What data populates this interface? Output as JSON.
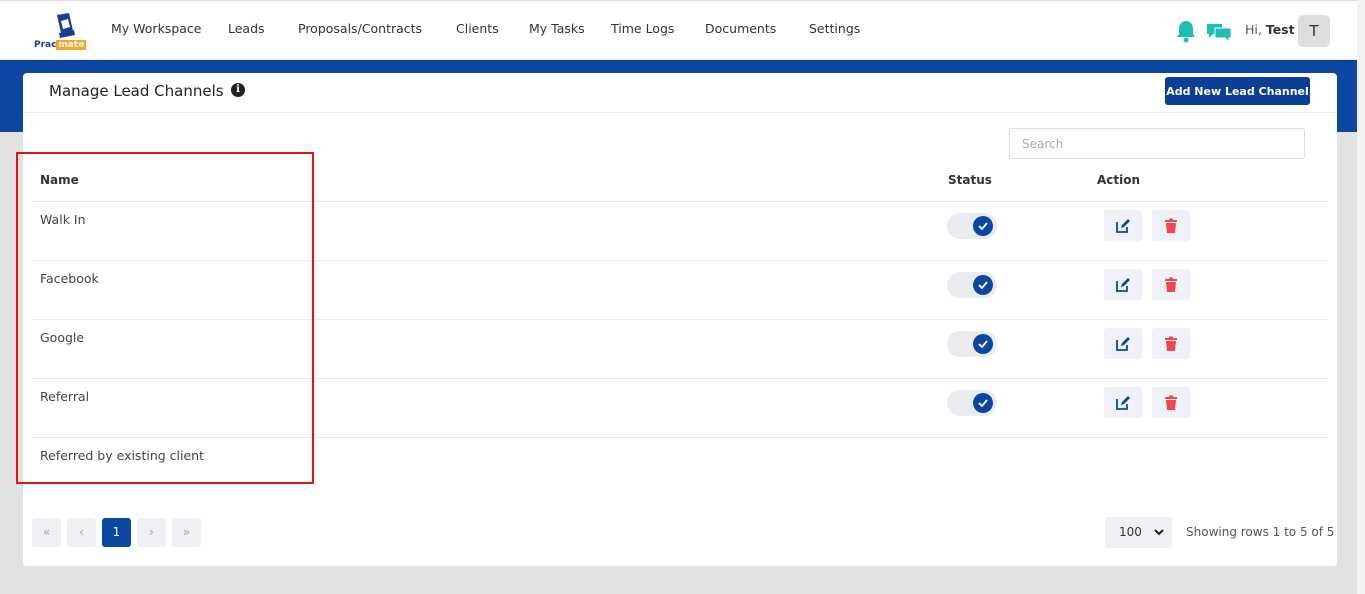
{
  "logo": {
    "part1": "Prac",
    "part2": "mate"
  },
  "nav": [
    {
      "label": "My Workspace"
    },
    {
      "label": "Leads"
    },
    {
      "label": "Proposals/Contracts"
    },
    {
      "label": "Clients"
    },
    {
      "label": "My Tasks"
    },
    {
      "label": "Time Logs"
    },
    {
      "label": "Documents"
    },
    {
      "label": "Settings"
    }
  ],
  "user": {
    "greeting": "Hi, ",
    "name": "Test",
    "avatar_initial": "T"
  },
  "page": {
    "title": "Manage Lead Channels",
    "add_button": "Add New Lead Channel",
    "search_placeholder": "Search"
  },
  "table": {
    "headers": {
      "name": "Name",
      "status": "Status",
      "action": "Action"
    },
    "rows": [
      {
        "name": "Walk In",
        "active": true
      },
      {
        "name": "Facebook",
        "active": true
      },
      {
        "name": "Google",
        "active": true
      },
      {
        "name": "Referral",
        "active": true
      },
      {
        "name": "Referred by existing client"
      }
    ]
  },
  "pagination": {
    "first": "«",
    "prev": "‹",
    "current": "1",
    "next": "›",
    "last": "»",
    "rows_per_page": "100",
    "showing": "Showing rows 1 to  5 of 5"
  },
  "colors": {
    "primary": "#0b47a0",
    "accent": "#1fbfb0",
    "danger": "#f0474f",
    "highlight": "#e01515"
  }
}
